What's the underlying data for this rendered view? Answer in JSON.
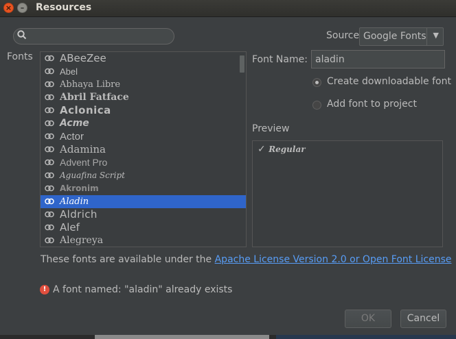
{
  "window": {
    "title": "Resources"
  },
  "search": {
    "value": ""
  },
  "source": {
    "label": "Source",
    "selected": "Google Fonts"
  },
  "fonts": {
    "label": "Fonts",
    "items": [
      {
        "name": "ABeeZee"
      },
      {
        "name": "Abel"
      },
      {
        "name": "Abhaya Libre"
      },
      {
        "name": "Abril Fatface"
      },
      {
        "name": "Aclonica"
      },
      {
        "name": "Acme"
      },
      {
        "name": "Actor"
      },
      {
        "name": "Adamina"
      },
      {
        "name": "Advent Pro"
      },
      {
        "name": "Aguafina Script"
      },
      {
        "name": "Akronim"
      },
      {
        "name": "Aladin"
      },
      {
        "name": "Aldrich"
      },
      {
        "name": "Alef"
      },
      {
        "name": "Alegreya"
      }
    ],
    "selected": "Aladin"
  },
  "font_name": {
    "label": "Font Name:",
    "value": "aladin"
  },
  "options": {
    "downloadable": {
      "label": "Create downloadable font",
      "checked": true
    },
    "add_to_project": {
      "label": "Add font to project",
      "checked": false
    }
  },
  "preview": {
    "label": "Preview",
    "items": [
      {
        "check": "✓",
        "style": "Regular"
      }
    ]
  },
  "license": {
    "prefix": "These fonts are available under the ",
    "link": "Apache License Version 2.0 or Open Font License "
  },
  "error": {
    "message": "A font named: \"aladin\" already exists"
  },
  "buttons": {
    "ok": "OK",
    "cancel": "Cancel"
  },
  "colors": {
    "selection": "#2f65ca",
    "link": "#589df6",
    "error": "#e04f3e",
    "background": "#3c3f41"
  }
}
